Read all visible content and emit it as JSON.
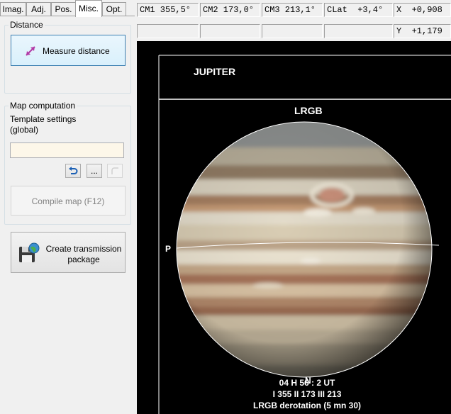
{
  "tabs": [
    {
      "label": "Imag."
    },
    {
      "label": "Adj."
    },
    {
      "label": "Pos."
    },
    {
      "label": "Misc."
    },
    {
      "label": "Opt."
    }
  ],
  "distance": {
    "legend": "Distance",
    "measure_label": "Measure distance"
  },
  "map": {
    "legend": "Map computation",
    "template_label_1": "Template settings",
    "template_label_2": "(global)",
    "template_value": "",
    "compile_label": "Compile map (F12)",
    "browse_label": "..."
  },
  "transmission": {
    "line1": "Create transmission",
    "line2": "package"
  },
  "status": {
    "cm1": "CM1 355,5°",
    "cm2": "CM2 173,0°",
    "cm3": "CM3 213,1°",
    "clat": "CLat  +3,4°",
    "x": "X  +0,908",
    "y": "Y  +1,179"
  },
  "image": {
    "object": "JUPITER",
    "filter": "LRGB",
    "left_marker": "P",
    "bottom_marker": "N",
    "time_line": "04 H 56 : 2 UT",
    "cm_line": "I 355  II 173  III 213",
    "derot_line": "LRGB derotation (5 mn 30)"
  }
}
